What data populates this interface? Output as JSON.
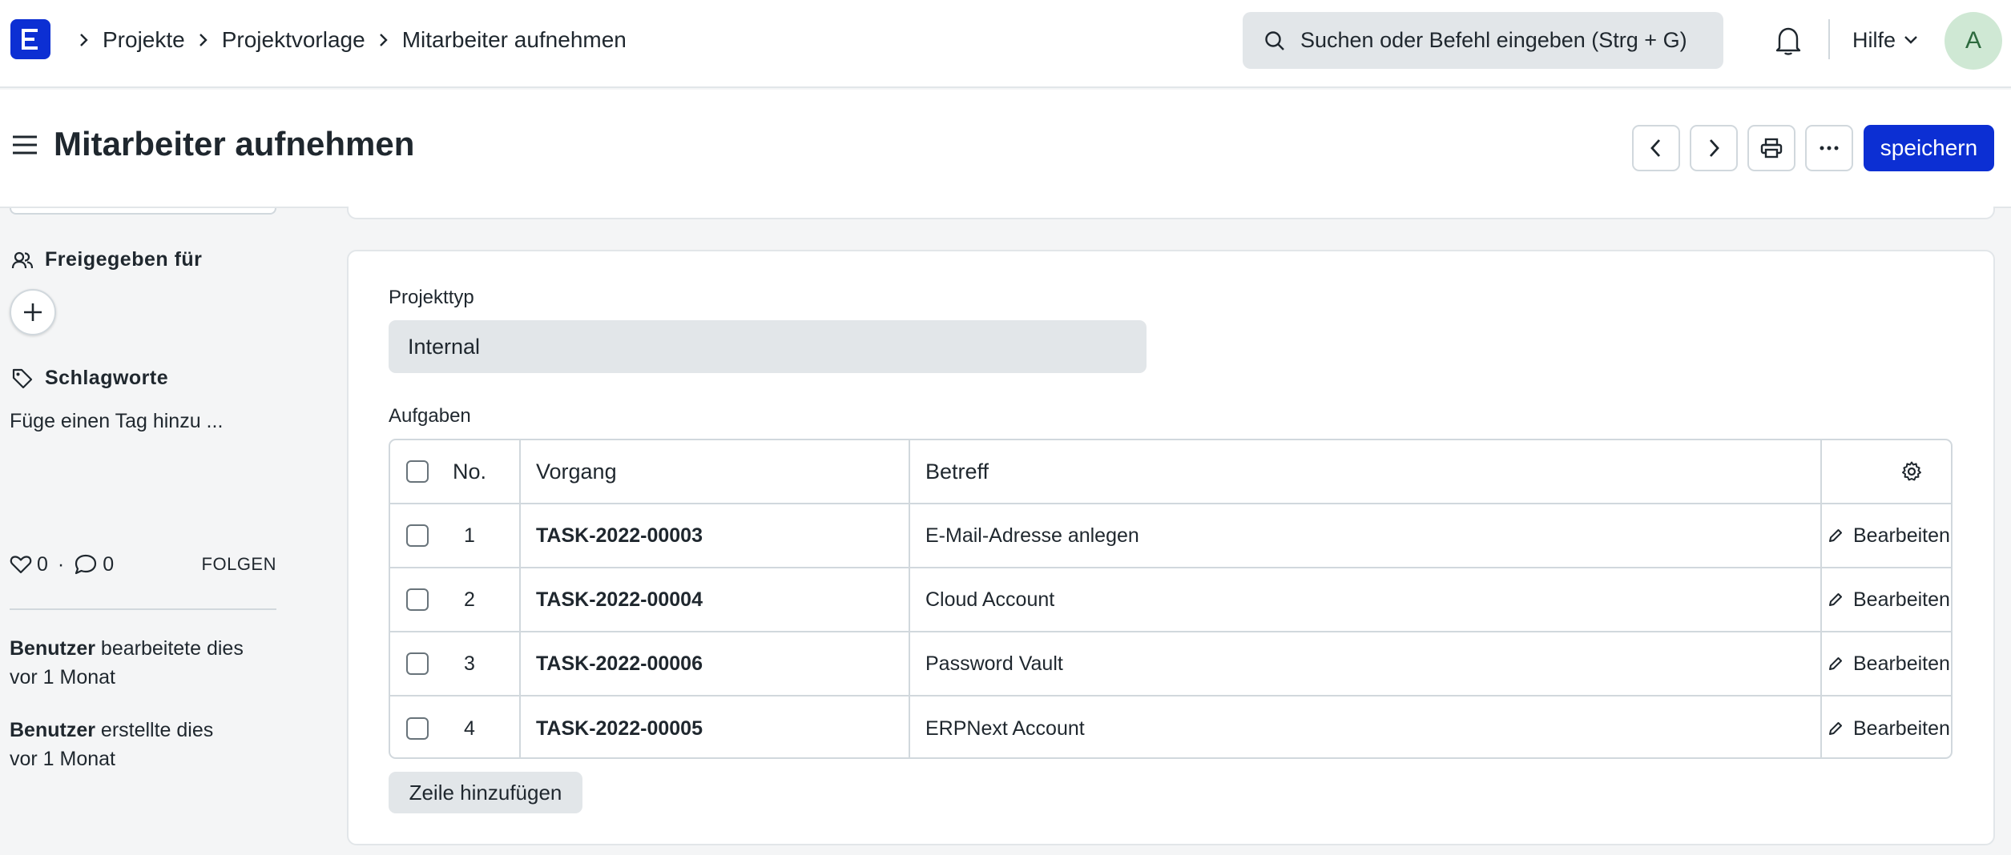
{
  "navbar": {
    "logo_letter": "E",
    "breadcrumbs": [
      "Projekte",
      "Projektvorlage",
      "Mitarbeiter aufnehmen"
    ],
    "search_placeholder": "Suchen oder Befehl eingeben (Strg + G)",
    "help_label": "Hilfe",
    "avatar_initial": "A"
  },
  "page": {
    "title": "Mitarbeiter aufnehmen",
    "save_label": "speichern"
  },
  "sidebar": {
    "shared_label": "Freigegeben für",
    "tags_label": "Schlagworte",
    "tag_hint": "Füge einen Tag hinzu ...",
    "likes": "0",
    "comments": "0",
    "separator": "·",
    "follow_label": "FOLGEN",
    "activity": [
      {
        "user": "Benutzer",
        "action": "bearbeitete dies",
        "time": "vor 1 Monat"
      },
      {
        "user": "Benutzer",
        "action": "erstellte dies",
        "time": "vor 1 Monat"
      }
    ]
  },
  "form": {
    "project_type_label": "Projekttyp",
    "project_type_value": "Internal",
    "tasks_label": "Aufgaben",
    "columns": {
      "no": "No.",
      "task": "Vorgang",
      "subject": "Betreff"
    },
    "rows": [
      {
        "no": "1",
        "task": "TASK-2022-00003",
        "subject": "E-Mail-Adresse anlegen",
        "edit": "Bearbeiten"
      },
      {
        "no": "2",
        "task": "TASK-2022-00004",
        "subject": "Cloud Account",
        "edit": "Bearbeiten"
      },
      {
        "no": "3",
        "task": "TASK-2022-00006",
        "subject": "Password Vault",
        "edit": "Bearbeiten"
      },
      {
        "no": "4",
        "task": "TASK-2022-00005",
        "subject": "ERPNext Account",
        "edit": "Bearbeiten"
      }
    ],
    "add_row_label": "Zeile hinzufügen"
  },
  "colors": {
    "primary": "#0c2fd3",
    "border": "#d1d8dd",
    "control_bg": "#e2e6e9",
    "avatar_bg": "#cfe8d4"
  }
}
